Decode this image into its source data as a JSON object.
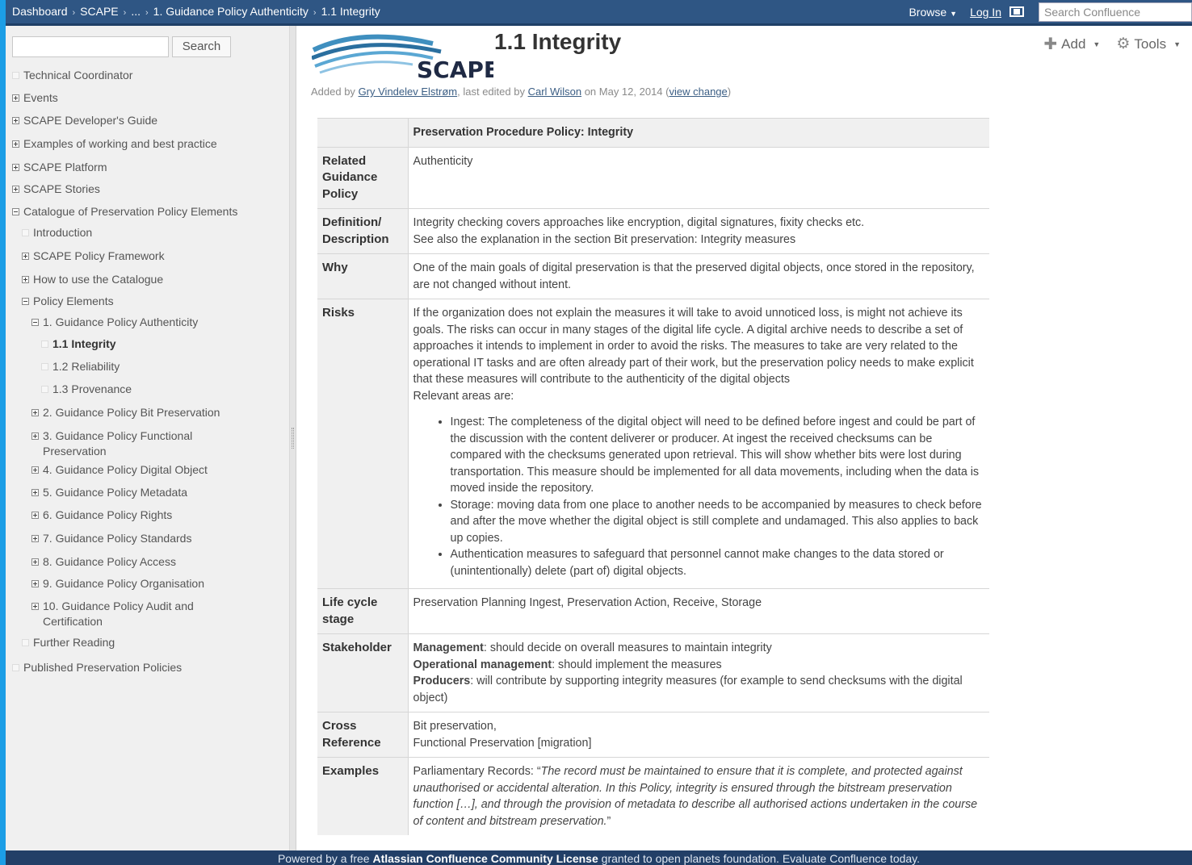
{
  "topbar": {
    "breadcrumb": [
      "Dashboard",
      "SCAPE",
      "...",
      "1. Guidance Policy Authenticity",
      "1.1 Integrity"
    ],
    "browse_label": "Browse",
    "login_label": "Log In",
    "search_placeholder": "Search Confluence"
  },
  "sidebar": {
    "search_button": "Search",
    "items": [
      {
        "label": "Technical Coordinator"
      },
      {
        "label": "Events"
      },
      {
        "label": "SCAPE Developer's Guide"
      },
      {
        "label": "Examples of working and best practice"
      },
      {
        "label": "SCAPE Platform"
      },
      {
        "label": "SCAPE Stories"
      },
      {
        "label": "Catalogue of Preservation Policy Elements"
      },
      {
        "label": "Introduction"
      },
      {
        "label": "SCAPE Policy Framework"
      },
      {
        "label": "How to use the Catalogue"
      },
      {
        "label": "Policy Elements"
      },
      {
        "label": "1. Guidance Policy Authenticity"
      },
      {
        "label": "1.1 Integrity"
      },
      {
        "label": "1.2 Reliability"
      },
      {
        "label": "1.3 Provenance"
      },
      {
        "label": "2. Guidance Policy Bit Preservation"
      },
      {
        "label": "3. Guidance Policy Functional Preservation"
      },
      {
        "label": "4. Guidance Policy Digital Object"
      },
      {
        "label": "5. Guidance Policy Metadata"
      },
      {
        "label": "6. Guidance Policy Rights"
      },
      {
        "label": "7. Guidance Policy Standards"
      },
      {
        "label": "8. Guidance Policy Access"
      },
      {
        "label": "9. Guidance Policy Organisation"
      },
      {
        "label": "10. Guidance Policy Audit and Certification"
      },
      {
        "label": "Further Reading"
      },
      {
        "label": "Published Preservation Policies"
      }
    ]
  },
  "page": {
    "logo_text": "SCAPE",
    "title": "1.1 Integrity",
    "meta": {
      "added_by_prefix": "Added by",
      "author": "Gry Vindelev Elstrøm",
      "edited_prefix": ", last edited by",
      "editor": "Carl Wilson",
      "date": "on May 12, 2014",
      "view_change": "view change"
    },
    "actions": {
      "add": "Add",
      "tools": "Tools"
    }
  },
  "table": {
    "header": "Preservation Procedure Policy: Integrity",
    "related_label": "Related Guidance Policy",
    "related_value": "Authenticity",
    "definition_label": "Definition/ Description",
    "definition_lines": [
      "Integrity checking covers approaches like encryption, digital signatures, fixity checks etc.",
      "See also the explanation in the section Bit preservation: Integrity measures"
    ],
    "why_label": "Why",
    "why_value": "One of the main goals of digital preservation is that the preserved digital objects, once stored in the repository, are not changed without intent.",
    "risks_label": "Risks",
    "risks_paragraph": "If the organization does not explain the measures it will take to avoid unnoticed loss, is might not achieve its goals. The risks can occur in many stages of the digital life cycle. A digital archive needs to describe a set of approaches it intends to implement in order to avoid the risks. The measures to take are very related to the operational IT tasks and are often already part of their work, but the preservation policy needs to make explicit that these measures will contribute to the authenticity of the digital objects",
    "risks_relevant": "Relevant areas are:",
    "risks_bullets": [
      "Ingest: The completeness of the digital object will need to be defined before ingest and could be part of the discussion with the content deliverer or producer. At ingest the received checksums can be compared with the checksums generated upon retrieval. This will show whether bits were lost during transportation. This measure should be implemented for all data movements, including when the data is moved inside the repository.",
      "Storage: moving data from one place to another needs to be accompanied by measures to check before and after the move whether the digital object is still complete and undamaged.  This also applies to back up copies.",
      " Authentication measures to safeguard that personnel cannot make changes to the data stored or (unintentionally) delete (part of) digital objects."
    ],
    "lifecycle_label": "Life cycle stage",
    "lifecycle_value": "Preservation Planning Ingest, Preservation Action, Receive, Storage",
    "stakeholder_label": "Stakeholder",
    "stakeholders": [
      {
        "role": "Management",
        "text": ": should decide on overall measures to maintain integrity"
      },
      {
        "role": "Operational management",
        "text": ": should implement the measures"
      },
      {
        "role": "Producers",
        "text": ": will contribute by supporting integrity measures (for example to send checksums with the digital object)"
      }
    ],
    "crossref_label": "Cross Reference",
    "crossref_lines": [
      "Bit preservation,",
      "Functional Preservation [migration]"
    ],
    "examples_label": "Examples",
    "examples_prefix": "Parliamentary Records: “",
    "examples_quote": "The record must be maintained to ensure that it is complete, and protected against unauthorised or accidental alteration. In this Policy, integrity is ensured through the bitstream preservation function […], and through the provision of metadata to describe all authorised actions undertaken in the course of content and bitstream preservation.",
    "examples_suffix": "”"
  },
  "footer": {
    "prefix": "Powered by a free",
    "license": "Atlassian Confluence Community License",
    "suffix": "granted to open planets foundation. Evaluate Confluence today."
  }
}
